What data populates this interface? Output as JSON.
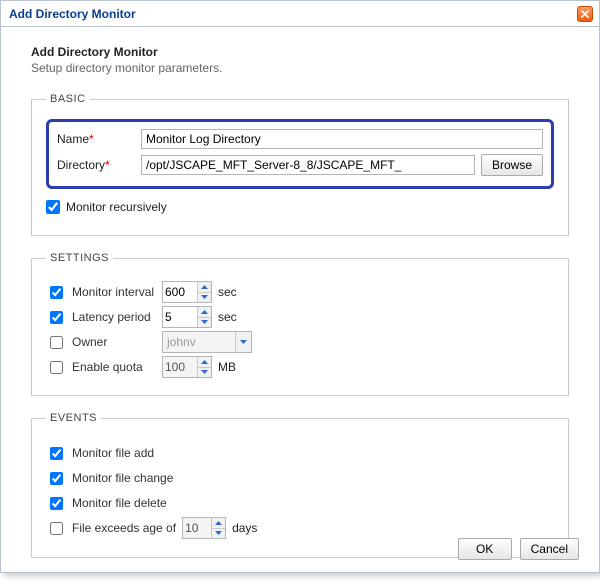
{
  "window": {
    "title": "Add Directory Monitor"
  },
  "header": {
    "title": "Add Directory Monitor",
    "subtitle": "Setup directory monitor parameters."
  },
  "basic": {
    "legend": "BASIC",
    "name_label": "Name",
    "name_value": "Monitor Log Directory",
    "dir_label": "Directory",
    "dir_value": "/opt/JSCAPE_MFT_Server-8_8/JSCAPE_MFT_",
    "browse_label": "Browse",
    "recursive_label": "Monitor recursively",
    "recursive_checked": true
  },
  "settings": {
    "legend": "SETTINGS",
    "monitor_interval_label": "Monitor interval",
    "monitor_interval_checked": true,
    "monitor_interval_value": "600",
    "latency_label": "Latency period",
    "latency_checked": true,
    "latency_value": "5",
    "sec_unit": "sec",
    "owner_label": "Owner",
    "owner_checked": false,
    "owner_value": "johnv",
    "quota_label": "Enable quota",
    "quota_checked": false,
    "quota_value": "100",
    "mb_unit": "MB"
  },
  "events": {
    "legend": "EVENTS",
    "file_add_label": "Monitor file add",
    "file_add_checked": true,
    "file_change_label": "Monitor file change",
    "file_change_checked": true,
    "file_delete_label": "Monitor file delete",
    "file_delete_checked": true,
    "age_label_prefix": "File exceeds age of",
    "age_checked": false,
    "age_value": "10",
    "age_unit": "days"
  },
  "footer": {
    "ok_label": "OK",
    "cancel_label": "Cancel"
  }
}
